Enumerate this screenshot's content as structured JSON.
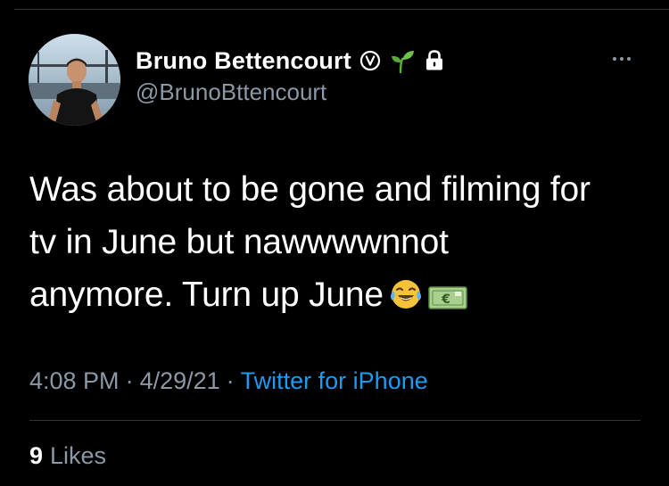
{
  "tweet": {
    "author": {
      "display_name": "Bruno Bettencourt",
      "handle": "@BrunoBttencourt",
      "name_icons": [
        "verified-style-v-icon",
        "seedling-emoji-icon",
        "lock-icon"
      ]
    },
    "more_icon": "more-dots-icon",
    "text_lines": [
      "Was about to be gone and filming for",
      "tv in June but nawwwwnnot",
      "anymore. Turn up June"
    ],
    "text_emojis": [
      "face-with-tears-of-joy-icon",
      "euro-banknote-icon"
    ],
    "meta": {
      "time": "4:08 PM",
      "separator": "·",
      "date": "4/29/21",
      "source": "Twitter for iPhone"
    },
    "likes": {
      "count": "9",
      "label": "Likes"
    }
  },
  "colors": {
    "background": "#000000",
    "text_primary": "#ffffff",
    "text_secondary": "#8b98a5",
    "link": "#1d9bf0",
    "divider": "#2f3336"
  }
}
